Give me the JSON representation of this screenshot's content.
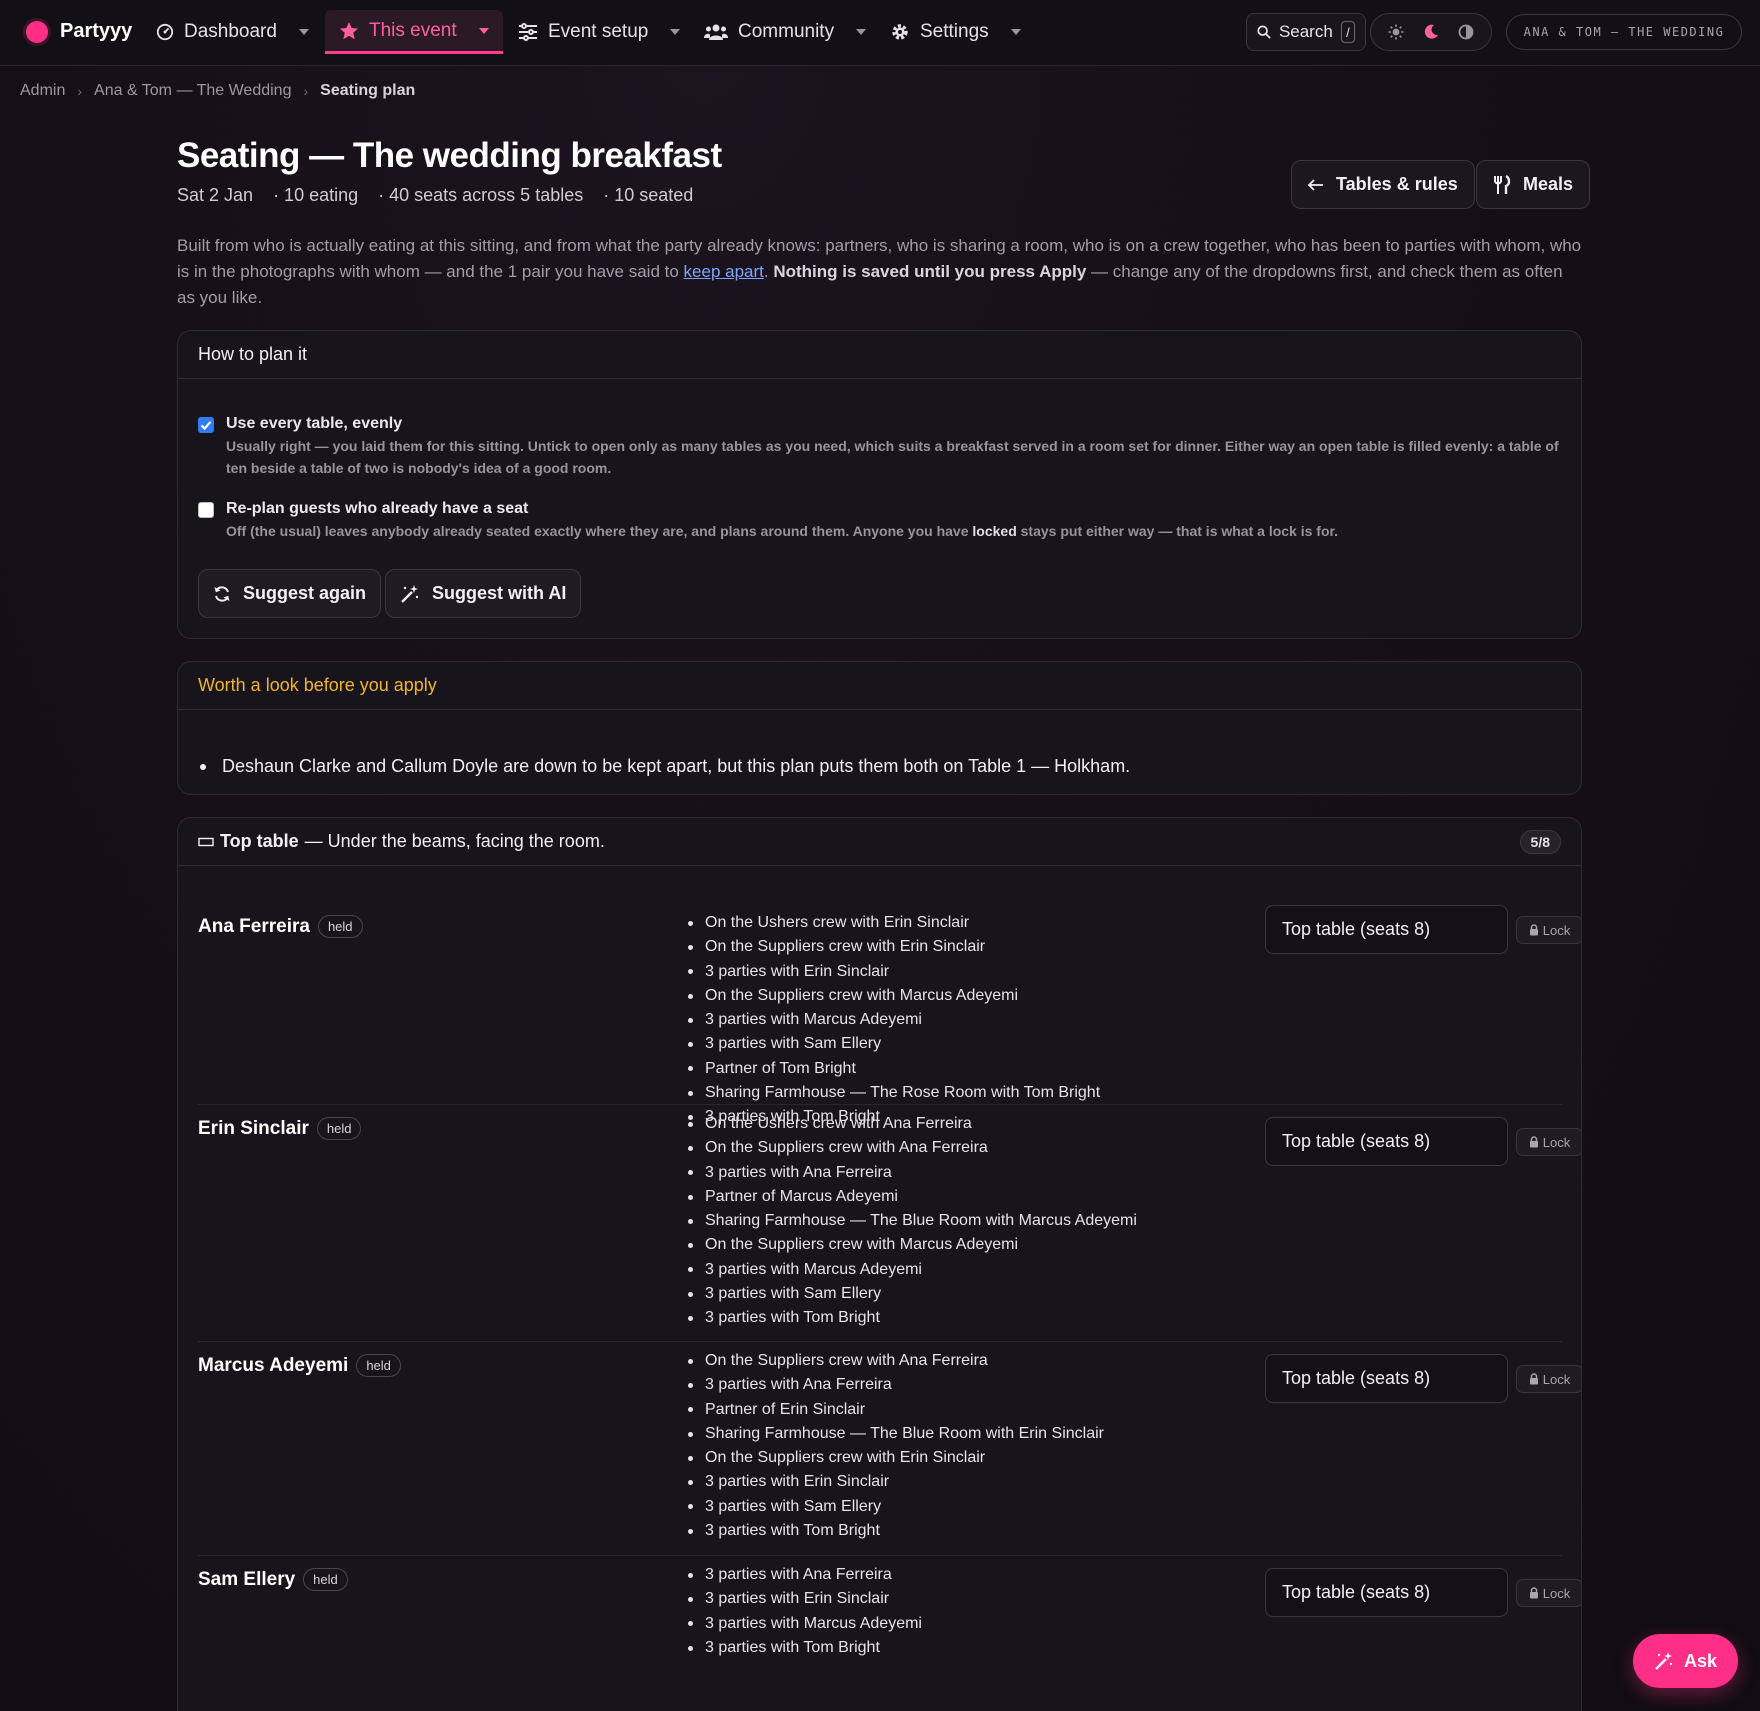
{
  "nav": {
    "brand": "Partyyy",
    "items": [
      {
        "label": "Dashboard"
      },
      {
        "label": "This event"
      },
      {
        "label": "Event setup"
      },
      {
        "label": "Community"
      },
      {
        "label": "Settings"
      }
    ],
    "search_label": "Search",
    "search_shortcut": "/",
    "event_pill": "ANA & TOM — THE WEDDING",
    "accent_color": "#ff2e86"
  },
  "breadcrumb": [
    "Admin",
    "Ana & Tom — The Wedding",
    "Seating plan"
  ],
  "header": {
    "title": "Seating — The wedding breakfast",
    "meta": [
      "Sat 2 Jan",
      "· 10 eating",
      "· 40 seats across 5 tables",
      "· 10 seated"
    ],
    "buttons": {
      "tables_rules": "Tables & rules",
      "meals": "Meals"
    }
  },
  "intro": {
    "part1": "Built from who is actually eating at this sitting, and from what the party already knows: partners, who is sharing a room, who is on a crew together, who has been to parties with whom, who is in the photographs with whom — and the 1 pair you have said to ",
    "link": "keep apart",
    "part2": ". ",
    "bold": "Nothing is saved until you press Apply",
    "part3": " — change any of the dropdowns first, and check them as often as you like."
  },
  "plan": {
    "heading": "How to plan it",
    "option1": {
      "label": "Use every table, evenly",
      "checked": true,
      "help": "Usually right — you laid them for this sitting. Untick to open only as many tables as you need, which suits a breakfast served in a room set for dinner. Either way an open table is filled evenly: a table of ten beside a table of two is nobody's idea of a good room."
    },
    "option2": {
      "label": "Re-plan guests who already have a seat",
      "checked": false,
      "help1": "Off (the usual) leaves anybody already seated exactly where they are, and plans around them. Anyone you have ",
      "help_bold": "locked",
      "help2": " stays put either way — that is what a lock is for."
    },
    "suggest_again": "Suggest again",
    "suggest_ai": "Suggest with AI"
  },
  "warning": {
    "heading": "Worth a look before you apply",
    "items": [
      "Deshaun Clarke and Callum Doyle are down to be kept apart, but this plan puts them both on Table 1 — Holkham."
    ],
    "color": "#f3b427"
  },
  "table": {
    "name": "Top table",
    "description": "— Under the beams, facing the room.",
    "count": "5/8",
    "guests": [
      {
        "name": "Ana Ferreira",
        "badge": "held",
        "seat": "Top table (seats 8)",
        "lock": "Lock",
        "facts": [
          "On the Ushers crew with Erin Sinclair",
          "On the Suppliers crew with Erin Sinclair",
          "3 parties with Erin Sinclair",
          "On the Suppliers crew with Marcus Adeyemi",
          "3 parties with Marcus Adeyemi",
          "3 parties with Sam Ellery",
          "Partner of Tom Bright",
          "Sharing Farmhouse — The Rose Room with Tom Bright",
          "3 parties with Tom Bright"
        ]
      },
      {
        "name": "Erin Sinclair",
        "badge": "held",
        "seat": "Top table (seats 8)",
        "lock": "Lock",
        "facts": [
          "On the Ushers crew with Ana Ferreira",
          "On the Suppliers crew with Ana Ferreira",
          "3 parties with Ana Ferreira",
          "Partner of Marcus Adeyemi",
          "Sharing Farmhouse — The Blue Room with Marcus Adeyemi",
          "On the Suppliers crew with Marcus Adeyemi",
          "3 parties with Marcus Adeyemi",
          "3 parties with Sam Ellery",
          "3 parties with Tom Bright"
        ]
      },
      {
        "name": "Marcus Adeyemi",
        "badge": "held",
        "seat": "Top table (seats 8)",
        "lock": "Lock",
        "facts": [
          "On the Suppliers crew with Ana Ferreira",
          "3 parties with Ana Ferreira",
          "Partner of Erin Sinclair",
          "Sharing Farmhouse — The Blue Room with Erin Sinclair",
          "On the Suppliers crew with Erin Sinclair",
          "3 parties with Erin Sinclair",
          "3 parties with Sam Ellery",
          "3 parties with Tom Bright"
        ]
      },
      {
        "name": "Sam Ellery",
        "badge": "held",
        "seat": "Top table (seats 8)",
        "lock": "Lock",
        "facts": [
          "3 parties with Ana Ferreira",
          "3 parties with Erin Sinclair",
          "3 parties with Marcus Adeyemi",
          "3 parties with Tom Bright"
        ]
      }
    ]
  },
  "ask_button": "Ask"
}
